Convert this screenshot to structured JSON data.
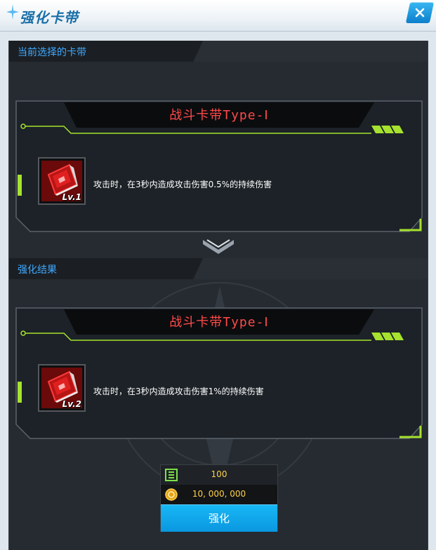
{
  "window": {
    "title": "强化卡带"
  },
  "current_section": {
    "label": "当前选择的卡带"
  },
  "result_section": {
    "label": "强化结果"
  },
  "current_card": {
    "name": "战斗卡带Type-Ⅰ",
    "level": "Lv.1",
    "description": "攻击时，在3秒内造成攻击伤害0.5%的持续伤害"
  },
  "result_card": {
    "name": "战斗卡带Type-Ⅰ",
    "level": "Lv.2",
    "description": "攻击时，在3秒内造成攻击伤害1%的持续伤害"
  },
  "cost": {
    "material_amount": "100",
    "gold_amount": "10, 000, 000",
    "material_icon": "chip-material-icon",
    "gold_icon": "gold-coin-icon"
  },
  "actions": {
    "enhance_label": "强化",
    "close_icon": "close-icon"
  },
  "colors": {
    "accent_green": "#a6e22e",
    "card_name_red": "#ff4a4a",
    "section_label_blue": "#3fa9ff",
    "button_blue": "#0ea6ec",
    "cost_text": "#ffd24a"
  }
}
